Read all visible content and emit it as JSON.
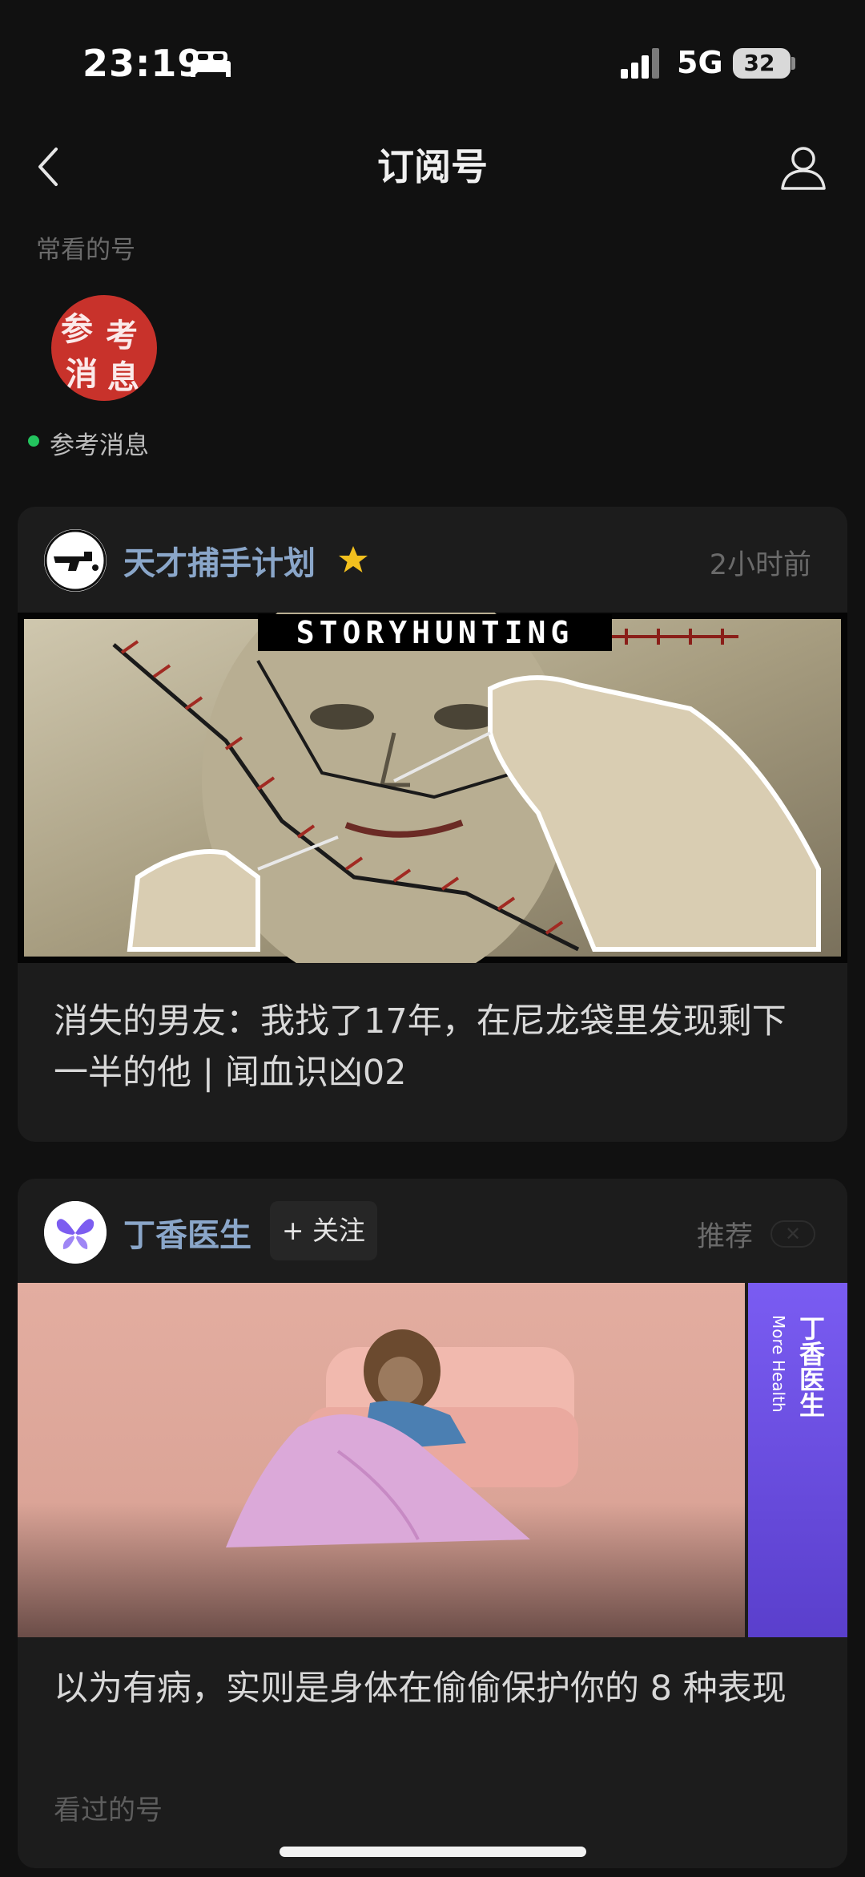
{
  "status_bar": {
    "time": "23:19",
    "network": "5G",
    "battery": "32"
  },
  "nav": {
    "title": "订阅号",
    "back_icon": "chevron-left-icon",
    "profile_icon": "person-icon"
  },
  "frequent": {
    "section_title": "常看的号",
    "accounts": [
      {
        "name": "参考消息",
        "logo_text": "参考消息",
        "online": true,
        "logo_color": "#c8322b"
      }
    ]
  },
  "feed": [
    {
      "account": "天才捕手计划",
      "starred": true,
      "time": "2小时前",
      "cover_banner": "STORYHUNTING",
      "title": "消失的男友：我找了17年，在尼龙袋里发现剩下一半的他 | 闻血识凶02"
    },
    {
      "account": "丁香医生",
      "follow_label": "+ 关注",
      "recommend_label": "推荐",
      "cover_side_title": "丁香医生",
      "cover_side_subtitle": "More Health",
      "title": "以为有病，实则是身体在偷偷保护你的 8 种表现",
      "footer_label": "看过的号"
    }
  ],
  "colors": {
    "background": "#111111",
    "card": "#1c1c1c",
    "account_name": "#8aa6c9",
    "star": "#f2c01e",
    "online_dot": "#23c45e",
    "brand_purple": "#6a4fe0"
  }
}
